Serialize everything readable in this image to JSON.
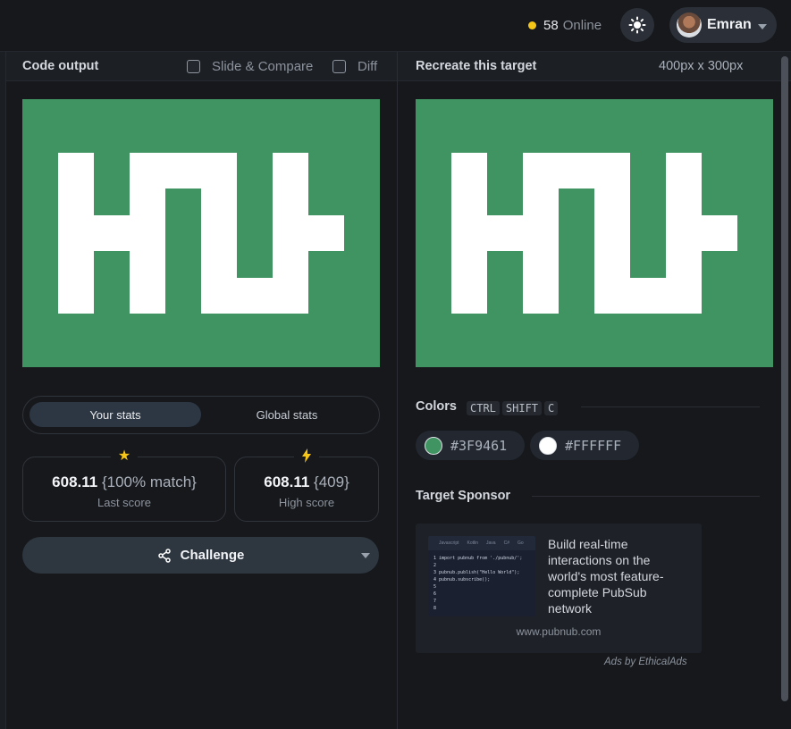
{
  "topbar": {
    "online_count": "58",
    "online_label": "Online",
    "theme_icon": "sun-icon",
    "user_name": "Emran"
  },
  "code_output": {
    "title": "Code output",
    "slide_compare_label": "Slide & Compare",
    "diff_label": "Diff"
  },
  "stats": {
    "tab_your": "Your stats",
    "tab_global": "Global stats",
    "last_score": "608.11",
    "last_match": "{100% match}",
    "last_label": "Last score",
    "high_score": "608.11",
    "high_rank": "{409}",
    "high_label": "High score",
    "challenge_label": "Challenge"
  },
  "target": {
    "title": "Recreate this target",
    "size": "400px x 300px"
  },
  "colors": {
    "title": "Colors",
    "shortcut_keys": [
      "CTRL",
      "SHIFT",
      "C"
    ],
    "swatches": [
      "#3F9461",
      "#FFFFFF"
    ]
  },
  "sponsor": {
    "title": "Target Sponsor",
    "ad_tabs": [
      "Javascript",
      "Kotlin",
      "Java",
      "C#",
      "Go"
    ],
    "code_lines": [
      "1 import pubnub from './pubnub/';",
      "2",
      "3 pubnub.publish(\"Hello World\");",
      "4 pubnub.subscribe();",
      "5",
      "6",
      "7",
      "8"
    ],
    "ad_text": "Build real-time interactions on the world's most feature-complete PubSub network",
    "ad_url": "www.pubnub.com",
    "ads_by": "Ads by EthicalAds"
  }
}
